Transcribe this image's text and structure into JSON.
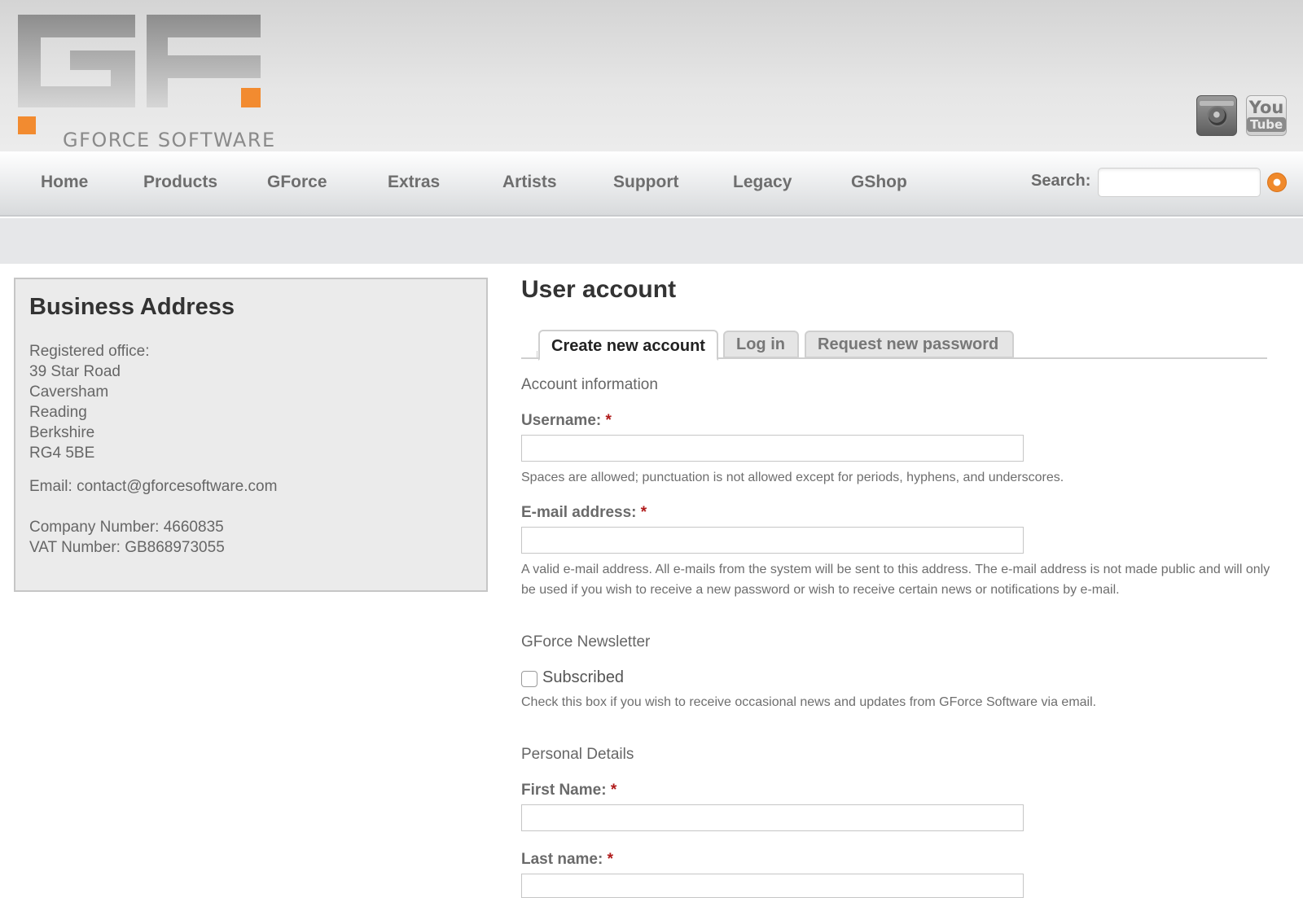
{
  "header": {
    "logo_text": "GFORCE SOFTWARE",
    "logo_icon": "gf-logo-icon",
    "brand_colors": {
      "orange": "#f28b30",
      "grey": "#9c9c9c"
    },
    "social": [
      {
        "name": "instagram",
        "icon": "camera-icon"
      },
      {
        "name": "youtube",
        "icon": "youtube-icon",
        "line1": "You",
        "line2": "Tube"
      }
    ]
  },
  "nav": {
    "items": [
      "Home",
      "Products",
      "GForce",
      "Extras",
      "Artists",
      "Support",
      "Legacy",
      "GShop"
    ],
    "search_label": "Search:",
    "search_value": "",
    "search_icon": "search-go-icon"
  },
  "sidebar": {
    "title": "Business Address",
    "lines": [
      "Registered office:",
      "39 Star Road",
      "Caversham",
      "Reading",
      "Berkshire",
      "RG4 5BE"
    ],
    "email": "Email: contact@gforcesoftware.com",
    "company_number": "Company Number: 4660835",
    "vat_number": "VAT Number: GB868973055"
  },
  "main": {
    "title": "User account",
    "tabs": [
      {
        "label": "Create new account",
        "active": true
      },
      {
        "label": "Log in",
        "active": false
      },
      {
        "label": "Request new password",
        "active": false
      }
    ],
    "account_info": "Account information",
    "required_marker": "*",
    "username": {
      "label": "Username:",
      "value": "",
      "help": "Spaces are allowed; punctuation is not allowed except for periods, hyphens, and underscores."
    },
    "email": {
      "label": "E-mail address:",
      "value": "",
      "help": "A valid e-mail address. All e-mails from the system will be sent to this address. The e-mail address is not made public and will only be used if you wish to receive a new password or wish to receive certain news or notifications by e-mail."
    },
    "newsletter": {
      "title": "GForce Newsletter",
      "checkbox_label": "Subscribed",
      "checked": false,
      "help": "Check this box if you wish to receive occasional news and updates from GForce Software via email."
    },
    "personal": {
      "title": "Personal Details",
      "first_name_label": "First Name:",
      "first_name_value": "",
      "last_name_label": "Last name:",
      "last_name_value": ""
    }
  }
}
